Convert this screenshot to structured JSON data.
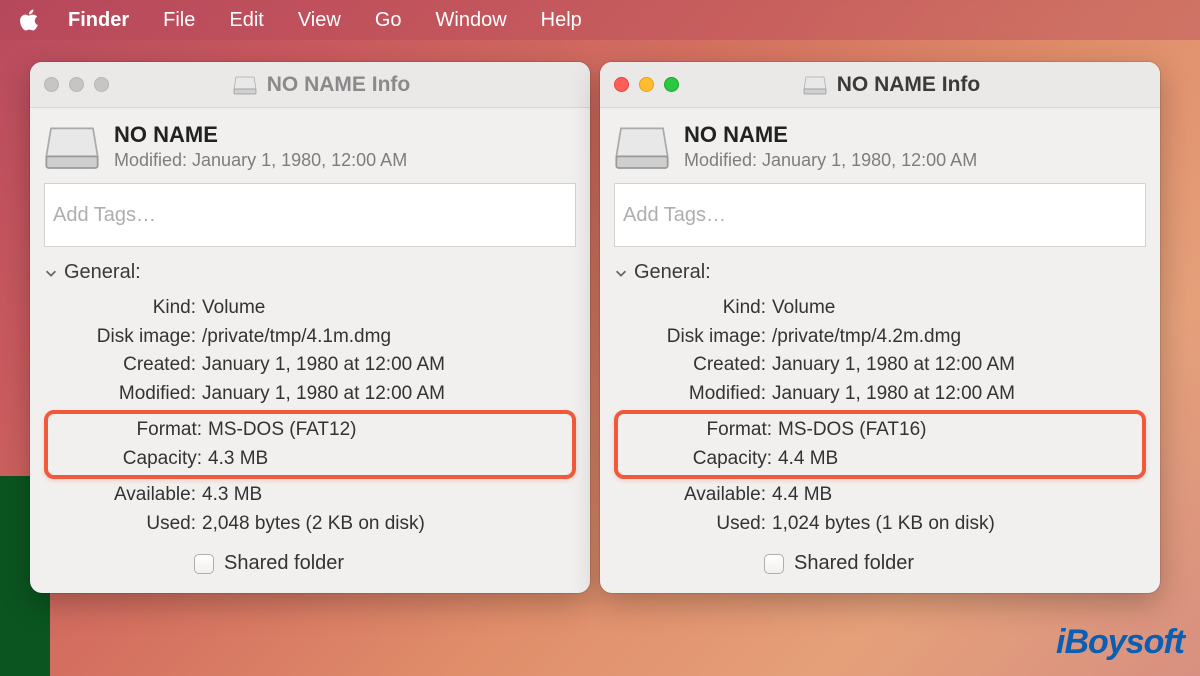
{
  "menubar": {
    "app": "Finder",
    "items": [
      "File",
      "Edit",
      "View",
      "Go",
      "Window",
      "Help"
    ]
  },
  "windows": [
    {
      "id": "left",
      "active": false,
      "title": "NO NAME Info",
      "name": "NO NAME",
      "modified_header": "Modified: January 1, 1980, 12:00 AM",
      "tags_placeholder": "Add Tags…",
      "section": "General:",
      "rows": [
        {
          "k": "Kind:",
          "v": "Volume"
        },
        {
          "k": "Disk image:",
          "v": "/private/tmp/4.1m.dmg"
        },
        {
          "k": "Created:",
          "v": "January 1, 1980 at 12:00 AM"
        },
        {
          "k": "Modified:",
          "v": "January 1, 1980 at 12:00 AM"
        }
      ],
      "highlight_rows": [
        {
          "k": "Format:",
          "v": "MS-DOS (FAT12)"
        },
        {
          "k": "Capacity:",
          "v": "4.3 MB"
        }
      ],
      "rows2": [
        {
          "k": "Available:",
          "v": "4.3 MB"
        },
        {
          "k": "Used:",
          "v": "2,048 bytes (2 KB on disk)"
        }
      ],
      "shared_label": "Shared folder"
    },
    {
      "id": "right",
      "active": true,
      "title": "NO NAME Info",
      "name": "NO NAME",
      "modified_header": "Modified: January 1, 1980, 12:00 AM",
      "tags_placeholder": "Add Tags…",
      "section": "General:",
      "rows": [
        {
          "k": "Kind:",
          "v": "Volume"
        },
        {
          "k": "Disk image:",
          "v": "/private/tmp/4.2m.dmg"
        },
        {
          "k": "Created:",
          "v": "January 1, 1980 at 12:00 AM"
        },
        {
          "k": "Modified:",
          "v": "January 1, 1980 at 12:00 AM"
        }
      ],
      "highlight_rows": [
        {
          "k": "Format:",
          "v": "MS-DOS (FAT16)"
        },
        {
          "k": "Capacity:",
          "v": "4.4 MB"
        }
      ],
      "rows2": [
        {
          "k": "Available:",
          "v": "4.4 MB"
        },
        {
          "k": "Used:",
          "v": "1,024 bytes (1 KB on disk)"
        }
      ],
      "shared_label": "Shared folder"
    }
  ],
  "watermark": "iBoysoft"
}
